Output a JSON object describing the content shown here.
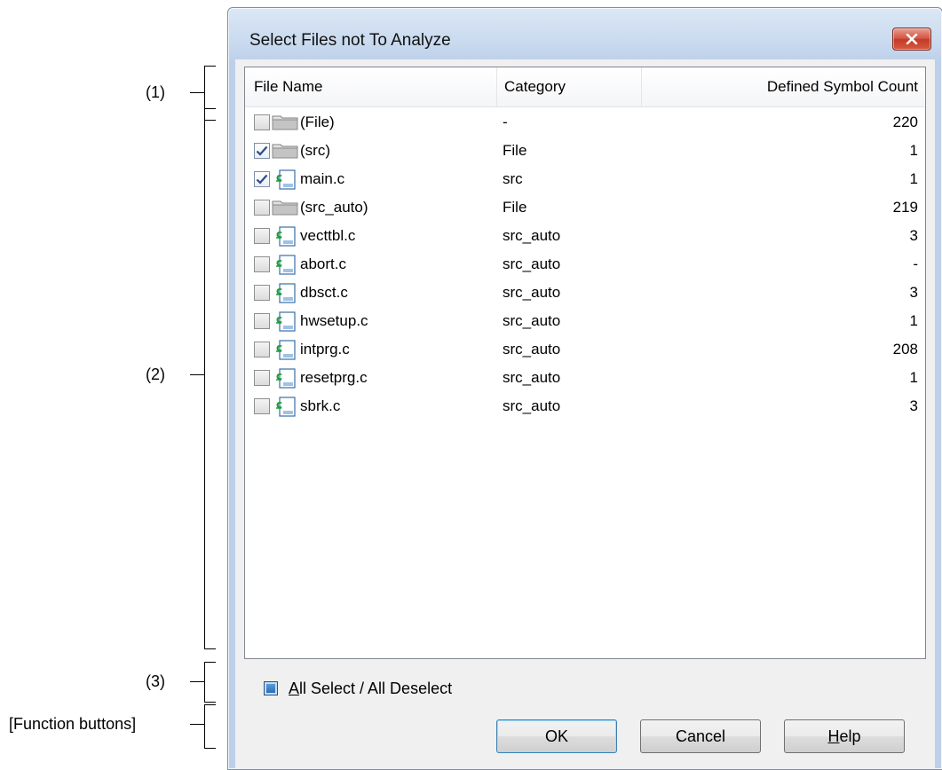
{
  "annotations": [
    {
      "label": "(1)"
    },
    {
      "label": "(2)"
    },
    {
      "label": "(3)"
    },
    {
      "label": "[Function buttons]"
    }
  ],
  "dialog": {
    "title": "Select Files not To Analyze",
    "close_icon": "close-x-icon"
  },
  "list": {
    "columns": [
      "File Name",
      "Category",
      "Defined Symbol Count"
    ],
    "rows": [
      {
        "name": "(File)",
        "category": "-",
        "count": "220",
        "checked": false,
        "icon": "folder-icon",
        "indent": 0
      },
      {
        "name": "(src)",
        "category": "File",
        "count": "1",
        "checked": true,
        "icon": "folder-icon",
        "indent": 0
      },
      {
        "name": "main.c",
        "category": "src",
        "count": "1",
        "checked": true,
        "icon": "c-file-icon",
        "indent": 0
      },
      {
        "name": "(src_auto)",
        "category": "File",
        "count": "219",
        "checked": false,
        "icon": "folder-icon",
        "indent": 0
      },
      {
        "name": "vecttbl.c",
        "category": "src_auto",
        "count": "3",
        "checked": false,
        "icon": "c-file-icon",
        "indent": 0
      },
      {
        "name": "abort.c",
        "category": "src_auto",
        "count": "-",
        "checked": false,
        "icon": "c-file-icon",
        "indent": 0
      },
      {
        "name": "dbsct.c",
        "category": "src_auto",
        "count": "3",
        "checked": false,
        "icon": "c-file-icon",
        "indent": 0
      },
      {
        "name": "hwsetup.c",
        "category": "src_auto",
        "count": "1",
        "checked": false,
        "icon": "c-file-icon",
        "indent": 0
      },
      {
        "name": "intprg.c",
        "category": "src_auto",
        "count": "208",
        "checked": false,
        "icon": "c-file-icon",
        "indent": 0
      },
      {
        "name": "resetprg.c",
        "category": "src_auto",
        "count": "1",
        "checked": false,
        "icon": "c-file-icon",
        "indent": 0
      },
      {
        "name": "sbrk.c",
        "category": "src_auto",
        "count": "3",
        "checked": false,
        "icon": "c-file-icon",
        "indent": 0
      }
    ]
  },
  "all_select": {
    "label_mnemonic": "A",
    "label_rest": "ll Select / All Deselect",
    "state": "indeterminate"
  },
  "buttons": {
    "ok": "OK",
    "cancel": "Cancel",
    "help_mnemonic": "H",
    "help_rest": "elp"
  },
  "colors": {
    "title_bar": "#c9daef",
    "close_button": "#c4392a",
    "client_bg": "#f0f0f0",
    "default_button_border": "#3c7fb1"
  }
}
